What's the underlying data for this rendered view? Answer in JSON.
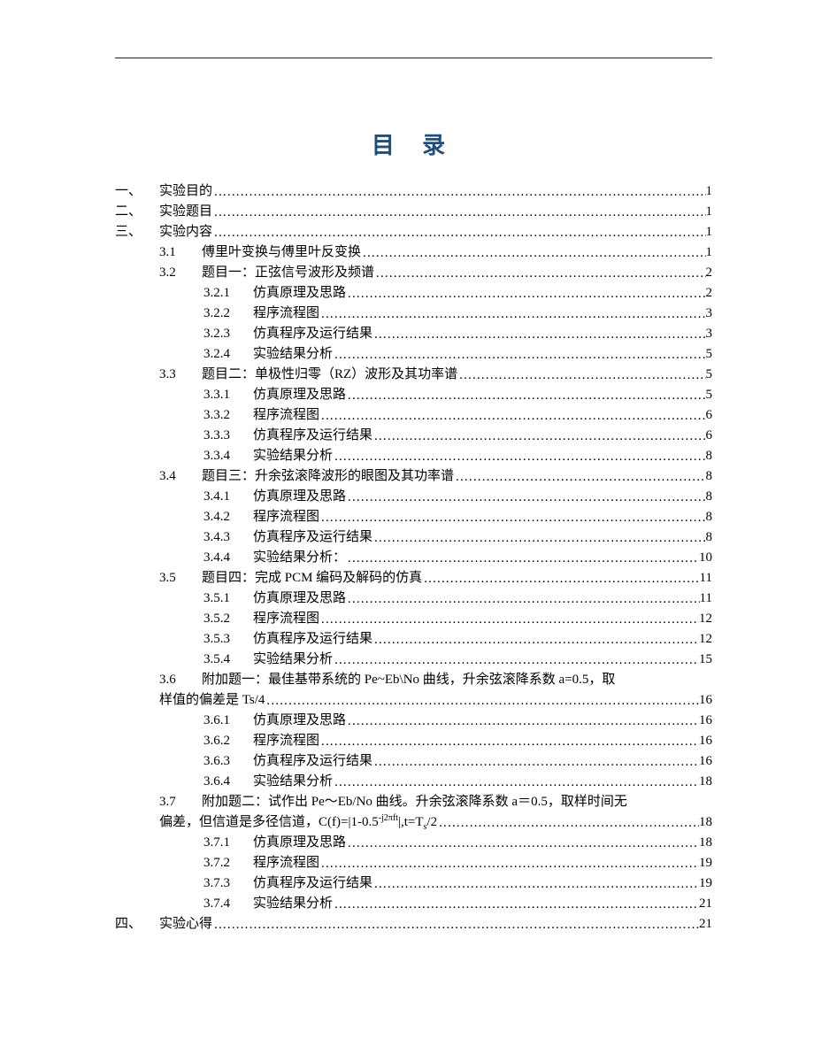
{
  "title": "目 录",
  "toc": [
    {
      "lvl": 0,
      "num": "一、",
      "text": "实验目的",
      "page": "1"
    },
    {
      "lvl": 0,
      "num": "二、",
      "text": "实验题目",
      "page": "1"
    },
    {
      "lvl": 0,
      "num": "三、",
      "text": "实验内容",
      "page": "1"
    },
    {
      "lvl": 1,
      "num": "3.1",
      "text": "傅里叶变换与傅里叶反变换",
      "page": "1"
    },
    {
      "lvl": 1,
      "num": "3.2",
      "text": "题目一：正弦信号波形及频谱",
      "page": "2"
    },
    {
      "lvl": 2,
      "num": "3.2.1",
      "text": "仿真原理及思路",
      "page": "2"
    },
    {
      "lvl": 2,
      "num": "3.2.2",
      "text": "程序流程图",
      "page": "3"
    },
    {
      "lvl": 2,
      "num": "3.2.3",
      "text": "仿真程序及运行结果",
      "page": "3"
    },
    {
      "lvl": 2,
      "num": "3.2.4",
      "text": "实验结果分析",
      "page": "5"
    },
    {
      "lvl": 1,
      "num": "3.3",
      "text": "题目二：单极性归零（RZ）波形及其功率谱",
      "page": "5"
    },
    {
      "lvl": 2,
      "num": "3.3.1",
      "text": "仿真原理及思路",
      "page": "5"
    },
    {
      "lvl": 2,
      "num": "3.3.2",
      "text": "程序流程图",
      "page": "6"
    },
    {
      "lvl": 2,
      "num": "3.3.3",
      "text": "仿真程序及运行结果",
      "page": "6"
    },
    {
      "lvl": 2,
      "num": "3.3.4",
      "text": "实验结果分析",
      "page": "8"
    },
    {
      "lvl": 1,
      "num": "3.4",
      "text": "题目三：升余弦滚降波形的眼图及其功率谱",
      "page": "8"
    },
    {
      "lvl": 2,
      "num": "3.4.1",
      "text": "仿真原理及思路",
      "page": "8"
    },
    {
      "lvl": 2,
      "num": "3.4.2",
      "text": "程序流程图",
      "page": "8"
    },
    {
      "lvl": 2,
      "num": "3.4.3",
      "text": "仿真程序及运行结果",
      "page": "8"
    },
    {
      "lvl": 2,
      "num": "3.4.4",
      "text": "实验结果分析：",
      "page": "10"
    },
    {
      "lvl": 1,
      "num": "3.5",
      "text": "题目四：完成 PCM 编码及解码的仿真",
      "page": "11"
    },
    {
      "lvl": 2,
      "num": "3.5.1",
      "text": "仿真原理及思路",
      "page": "11"
    },
    {
      "lvl": 2,
      "num": "3.5.2",
      "text": "程序流程图",
      "page": "12"
    },
    {
      "lvl": 2,
      "num": "3.5.3",
      "text": "仿真程序及运行结果",
      "page": "12"
    },
    {
      "lvl": 2,
      "num": "3.5.4",
      "text": "实验结果分析",
      "page": "15"
    },
    {
      "lvl": 1,
      "num": "3.6",
      "wrap": true,
      "line1": "附加题一：最佳基带系统的 Pe~Eb\\No 曲线，升余弦滚降系数 a=0.5，取",
      "line2": "样值的偏差是 Ts/4",
      "page": "16"
    },
    {
      "lvl": 2,
      "num": "3.6.1",
      "text": "仿真原理及思路",
      "page": "16"
    },
    {
      "lvl": 2,
      "num": "3.6.2",
      "text": "程序流程图",
      "page": "16"
    },
    {
      "lvl": 2,
      "num": "3.6.3",
      "text": "仿真程序及运行结果",
      "page": "16"
    },
    {
      "lvl": 2,
      "num": "3.6.4",
      "text": "实验结果分析",
      "page": "18"
    },
    {
      "lvl": 1,
      "num": "3.7",
      "wrap": true,
      "line1": "附加题二：试作出 Pe～Eb/No 曲线。升余弦滚降系数 a＝0.5，取样时间无",
      "line2_html": "偏差，但信道是多径信道，C(f)=|1-0.5<sup>-j2πft</sup>|,t=T<sub>s</sub>/2",
      "page": "18"
    },
    {
      "lvl": 2,
      "num": "3.7.1",
      "text": "仿真原理及思路",
      "page": "18"
    },
    {
      "lvl": 2,
      "num": "3.7.2",
      "text": "程序流程图",
      "page": "19"
    },
    {
      "lvl": 2,
      "num": "3.7.3",
      "text": "仿真程序及运行结果",
      "page": "19"
    },
    {
      "lvl": 2,
      "num": "3.7.4",
      "text": "实验结果分析",
      "page": "21"
    },
    {
      "lvl": 0,
      "num": "四、",
      "text": "实验心得",
      "page": "21"
    }
  ]
}
